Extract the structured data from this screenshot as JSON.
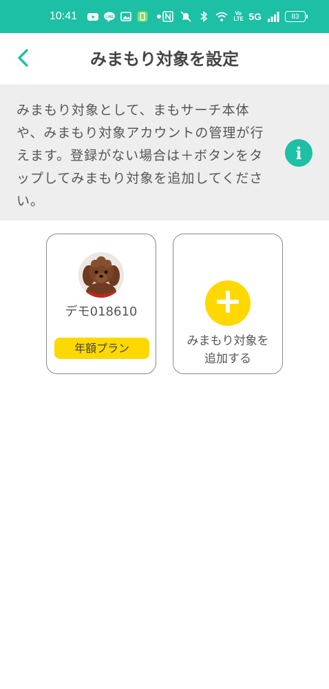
{
  "colors": {
    "accent": "#1dbfa5",
    "yellow": "#ffd800"
  },
  "status_bar": {
    "time": "10:41",
    "network": "5G",
    "volte": "Vo LTE",
    "battery": "83",
    "left_icons": [
      "youtube-icon",
      "line-icon",
      "gallery-icon",
      "app-icon",
      "dot-icon"
    ],
    "right_icons": [
      "nfc-icon",
      "mute-icon",
      "bluetooth-icon",
      "wifi-icon",
      "signal-icon",
      "battery-icon"
    ]
  },
  "header": {
    "back_icon": "chevron-left-icon",
    "title": "みまもり対象を設定"
  },
  "info": {
    "lines": [
      "みまもり対象として、まもサーチ本体",
      "や、みまもり対象アカウントの管理が行",
      "えます。登録がない場合は＋ボタンをタ",
      "ップしてみまもり対象を追加してくださ",
      "い。"
    ],
    "icon": "info-icon",
    "icon_glyph": "i"
  },
  "targets": [
    {
      "name": "デモ018610",
      "plan": "年額プラン",
      "avatar": "dog-avatar"
    }
  ],
  "add_card": {
    "icon": "plus-icon",
    "label_line1": "みまもり対象を",
    "label_line2": "追加する"
  }
}
